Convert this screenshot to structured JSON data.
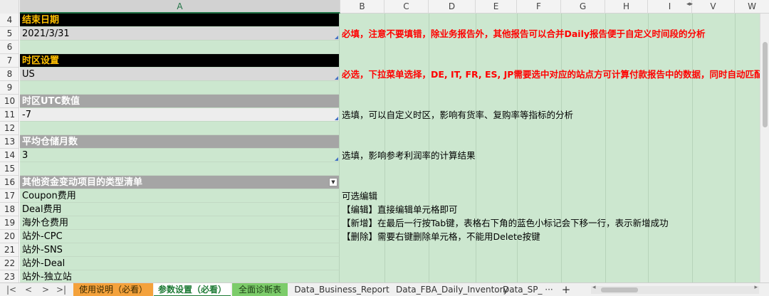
{
  "columns": {
    "A": "A",
    "B": "B",
    "C": "C",
    "D": "D",
    "E": "E",
    "F": "F",
    "G": "G",
    "H": "H",
    "I": "I",
    "V": "V",
    "W": "W"
  },
  "row_numbers": [
    "4",
    "5",
    "6",
    "7",
    "8",
    "9",
    "10",
    "11",
    "12",
    "13",
    "14",
    "15",
    "16",
    "17",
    "18",
    "19",
    "20",
    "21",
    "22",
    "23"
  ],
  "rows": {
    "r4": {
      "a": "结束日期"
    },
    "r5": {
      "a": "2021/3/31",
      "b": "必填，注意不要填错，除业务报告外，其他报告可以合并Daily报告便于自定义时间段的分析"
    },
    "r7": {
      "a": "时区设置"
    },
    "r8": {
      "a": "US",
      "b": "必选，下拉菜单选择，DE, IT, FR, ES, JP需要选中对应的站点方可计算付款报告中的数据，同时自动匹配"
    },
    "r10": {
      "a": "时区UTC数值"
    },
    "r11": {
      "a": "-7",
      "b": "选填，可以自定义时区，影响有货率、复购率等指标的分析"
    },
    "r13": {
      "a": "平均仓储月数"
    },
    "r14": {
      "a": "3",
      "b": "选填，影响参考利润率的计算结果"
    },
    "r16": {
      "a": "其他资金变动项目的类型清单"
    },
    "r17": {
      "a": "Coupon费用",
      "b": "可选编辑"
    },
    "r18": {
      "a": "Deal费用",
      "b": "【编辑】直接编辑单元格即可"
    },
    "r19": {
      "a": "海外仓费用",
      "b": "【新增】在最后一行按Tab键，表格右下角的蓝色小标记会下移一行，表示新增成功"
    },
    "r20": {
      "a": "站外-CPC",
      "b": "【删除】需要右键删除单元格，不能用Delete按键"
    },
    "r21": {
      "a": "站外-SNS"
    },
    "r22": {
      "a": "站外-Deal"
    },
    "r23": {
      "a": "站外-独立站"
    }
  },
  "sheet_tabs": {
    "tab1": "使用说明（必看）",
    "tab2": "参数设置（必看）",
    "tab3": "全面诊断表",
    "tab4": "Data_Business_Report",
    "tab5": "Data_FBA_Daily_Inventory",
    "tab6": "Data_SP_",
    "more": "···",
    "add": "+"
  },
  "colors": {
    "grid_green": "#cce7cf",
    "header_black": "#000000",
    "header_gold_text": "#ffc000",
    "header_gray": "#a5a5a5",
    "required_red": "#ff0000",
    "active_tab_green": "#1e7a35",
    "tab_orange": "#f4a23c",
    "tab_green": "#7ccc6a"
  }
}
